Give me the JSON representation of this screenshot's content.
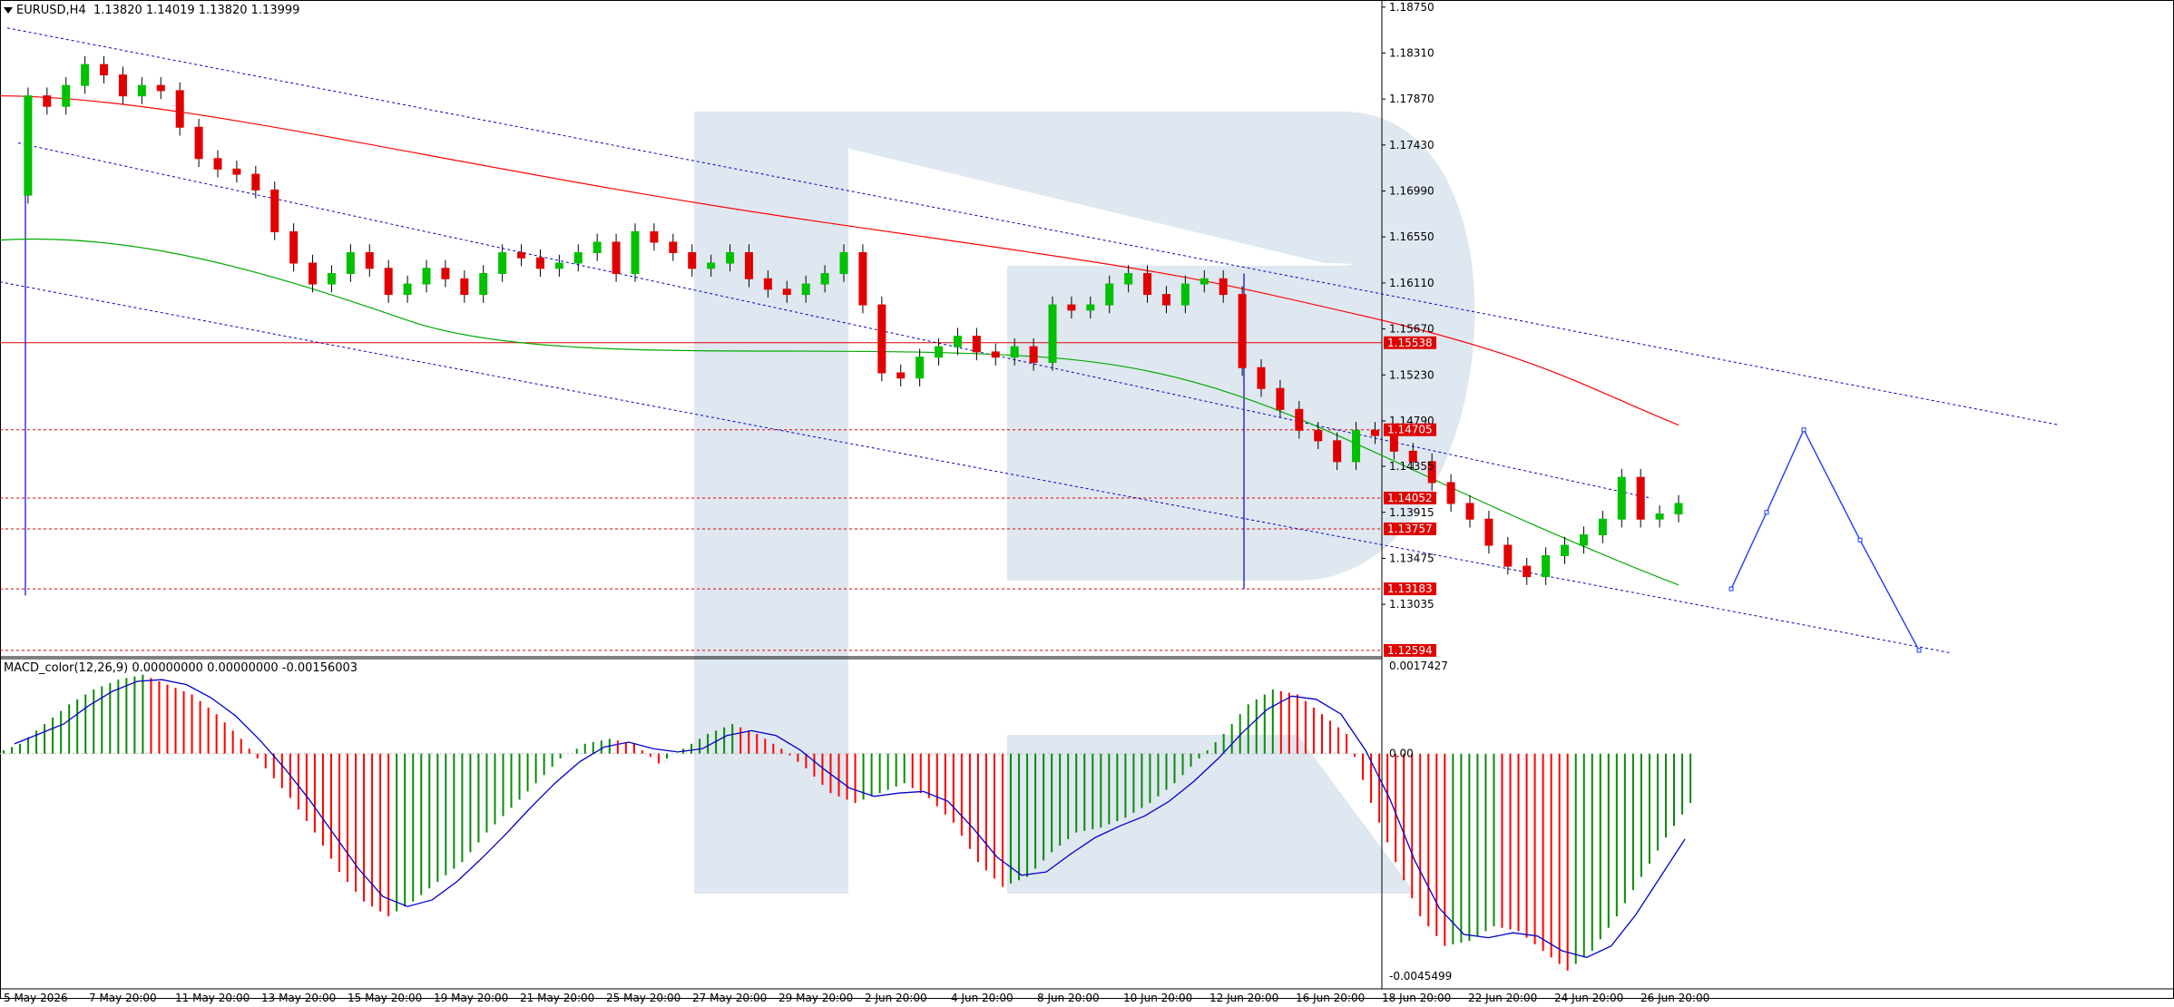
{
  "header": {
    "symbol": "EURUSD,H4",
    "ohlc": "1.13820 1.14019 1.13820 1.13999"
  },
  "macd": {
    "label": "MACD_color(12,26,9) 0.00000000 0.00000000 -0.00156003",
    "scale": [
      "0.0017427",
      "0.00",
      "-0.0045499"
    ],
    "colors": {
      "up": "#0a8a0a",
      "down": "#ff0000",
      "signal": "#0000cc"
    }
  },
  "colors": {
    "bull": "#00c000",
    "bear": "#e00000",
    "ma_red": "#ff0000",
    "ma_green": "#00aa00",
    "channel": "#0000cc",
    "level_line": "#e00000",
    "forecast": "#1e3cff",
    "watermark": "#d7e1ec"
  },
  "chart_data": {
    "type": "candlestick",
    "symbol": "EURUSD",
    "timeframe": "H4",
    "ylim": [
      1.1255,
      1.188
    ],
    "price_axis_labels": [
      "1.18750",
      "1.18310",
      "1.17870",
      "1.17430",
      "1.16990",
      "1.16550",
      "1.16110",
      "1.15670",
      "1.15230",
      "1.14790",
      "1.14355",
      "1.13915",
      "1.13475",
      "1.13035"
    ],
    "time_axis_labels": [
      "5 May 2026",
      "7 May 20:00",
      "11 May 20:00",
      "13 May 20:00",
      "15 May 20:00",
      "19 May 20:00",
      "21 May 20:00",
      "25 May 20:00",
      "27 May 20:00",
      "29 May 20:00",
      "2 Jun 20:00",
      "4 Jun 20:00",
      "8 Jun 20:00",
      "10 Jun 20:00",
      "12 Jun 20:00",
      "16 Jun 20:00",
      "18 Jun 20:00",
      "22 Jun 20:00",
      "24 Jun 20:00",
      "26 Jun 20:00"
    ],
    "levels": [
      {
        "price": 1.15538,
        "label": "1.15538",
        "style": "solid"
      },
      {
        "price": 1.14705,
        "label": "1.14705",
        "style": "dashed"
      },
      {
        "price": 1.14052,
        "label": "1.14052",
        "style": "dashed"
      },
      {
        "price": 1.13757,
        "label": "1.13757",
        "style": "dashed"
      },
      {
        "price": 1.13183,
        "label": "1.13183",
        "style": "dashed"
      },
      {
        "price": 1.12594,
        "label": "1.12594",
        "style": "dashed"
      }
    ],
    "close_path": [
      1.1695,
      1.179,
      1.178,
      1.18,
      1.182,
      1.181,
      1.179,
      1.18,
      1.1795,
      1.176,
      1.173,
      1.172,
      1.1715,
      1.17,
      1.166,
      1.163,
      1.161,
      1.162,
      1.164,
      1.1625,
      1.16,
      1.161,
      1.1625,
      1.1615,
      1.16,
      1.162,
      1.164,
      1.1635,
      1.1625,
      1.163,
      1.164,
      1.165,
      1.162,
      1.166,
      1.165,
      1.164,
      1.1625,
      1.163,
      1.164,
      1.1615,
      1.1605,
      1.16,
      1.161,
      1.162,
      1.164,
      1.159,
      1.1525,
      1.152,
      1.154,
      1.155,
      1.156,
      1.1545,
      1.154,
      1.155,
      1.1535,
      1.159,
      1.1585,
      1.159,
      1.161,
      1.162,
      1.16,
      1.159,
      1.161,
      1.1615,
      1.16,
      1.153,
      1.151,
      1.149,
      1.147,
      1.146,
      1.144,
      1.147,
      1.1465,
      1.145,
      1.144,
      1.142,
      1.14,
      1.1385,
      1.136,
      1.134,
      1.133,
      1.135,
      1.136,
      1.137,
      1.1385,
      1.1425,
      1.1385,
      1.139,
      1.14
    ],
    "forecast_path": [
      1.13183,
      1.13915,
      1.14705,
      1.1365,
      1.12594
    ],
    "macd_hist": [
      0.0002,
      0.0006,
      0.001,
      0.0013,
      0.0015,
      0.0016,
      0.0014,
      0.0012,
      0.0008,
      0.0003,
      -0.0003,
      -0.0009,
      -0.0016,
      -0.0024,
      -0.003,
      -0.0033,
      -0.003,
      -0.0026,
      -0.0022,
      -0.0016,
      -0.0011,
      -0.0006,
      -0.0001,
      0.0002,
      0.0003,
      0.0002,
      -0.0002,
      0.0001,
      0.0004,
      0.0006,
      0.0004,
      0.0001,
      -0.0003,
      -0.0008,
      -0.001,
      -0.0008,
      -0.0006,
      -0.0009,
      -0.0014,
      -0.0022,
      -0.0027,
      -0.0025,
      -0.002,
      -0.0016,
      -0.0015,
      -0.0013,
      -0.001,
      -0.0006,
      -0.0001,
      0.0004,
      0.001,
      0.0013,
      0.0012,
      0.0008,
      0.0004,
      -0.001,
      -0.0022,
      -0.0033,
      -0.0039,
      -0.0038,
      -0.0035,
      -0.0036,
      -0.004,
      -0.0044,
      -0.004,
      -0.0033,
      -0.0025,
      -0.0017,
      -0.001
    ]
  }
}
